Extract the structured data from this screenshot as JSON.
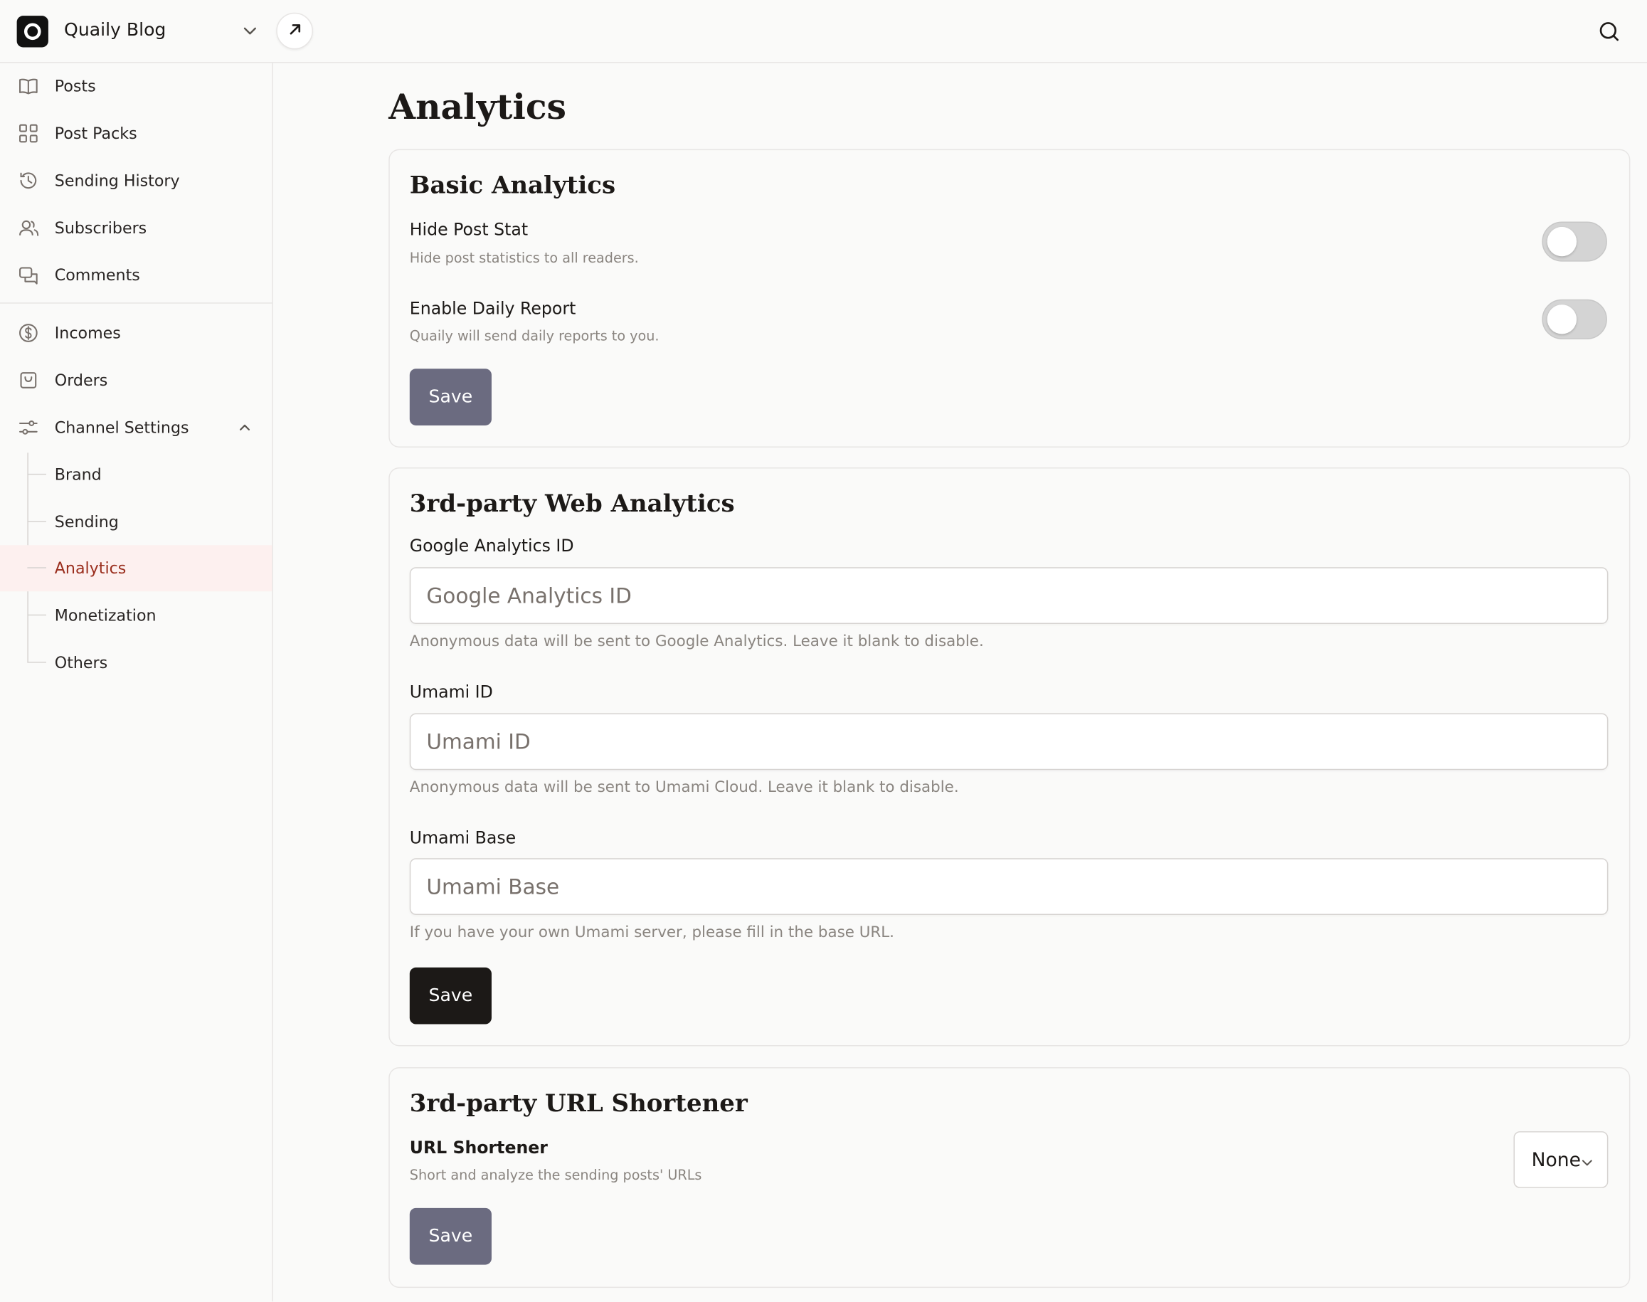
{
  "header": {
    "site_title": "Quaily Blog"
  },
  "sidebar": {
    "items": [
      {
        "label": "Posts",
        "icon": "book-open-icon"
      },
      {
        "label": "Post Packs",
        "icon": "grid-icon"
      },
      {
        "label": "Sending History",
        "icon": "history-icon"
      },
      {
        "label": "Subscribers",
        "icon": "users-icon"
      },
      {
        "label": "Comments",
        "icon": "comments-icon"
      },
      {
        "label": "Incomes",
        "icon": "dollar-circle-icon"
      },
      {
        "label": "Orders",
        "icon": "shopping-bag-icon"
      },
      {
        "label": "Channel Settings",
        "icon": "settings-sliders-icon"
      }
    ],
    "sub_items": [
      {
        "label": "Brand"
      },
      {
        "label": "Sending"
      },
      {
        "label": "Analytics"
      },
      {
        "label": "Monetization"
      },
      {
        "label": "Others"
      }
    ],
    "active_sub": "Analytics"
  },
  "main": {
    "title": "Analytics",
    "basic": {
      "title": "Basic Analytics",
      "hide_post_stat": {
        "label": "Hide Post Stat",
        "help": "Hide post statistics to all readers.",
        "enabled": false
      },
      "daily_report": {
        "label": "Enable Daily Report",
        "help": "Quaily will send daily reports to you.",
        "enabled": false
      },
      "save_label": "Save"
    },
    "web": {
      "title": "3rd-party Web Analytics",
      "ga": {
        "label": "Google Analytics ID",
        "placeholder": "Google Analytics ID",
        "value": "",
        "help": "Anonymous data will be sent to Google Analytics. Leave it blank to disable."
      },
      "umami_id": {
        "label": "Umami ID",
        "placeholder": "Umami ID",
        "value": "",
        "help": "Anonymous data will be sent to Umami Cloud. Leave it blank to disable."
      },
      "umami_base": {
        "label": "Umami Base",
        "placeholder": "Umami Base",
        "value": "",
        "help": "If you have your own Umami server, please fill in the base URL."
      },
      "save_label": "Save"
    },
    "shortener": {
      "title": "3rd-party URL Shortener",
      "label": "URL Shortener",
      "help": "Short and analyze the sending posts' URLs",
      "selected": "None",
      "save_label": "Save"
    }
  },
  "colors": {
    "active_bg": "#fdf0ef",
    "active_text": "#9a2e1d",
    "muted_button": "#6b6b80",
    "dark_button": "#1c1917"
  }
}
